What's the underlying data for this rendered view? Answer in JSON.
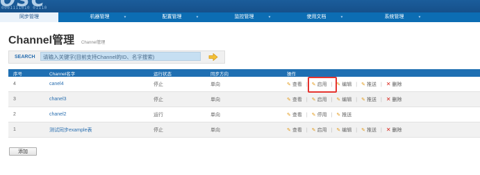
{
  "header": {
    "logo_text": "OSC",
    "logo_bits": "0001111010 01110"
  },
  "nav": {
    "items": [
      {
        "label": "同步管理",
        "active": true
      },
      {
        "label": "机器管理",
        "active": false
      },
      {
        "label": "配置管理",
        "active": false
      },
      {
        "label": "监控管理",
        "active": false
      },
      {
        "label": "使用文档",
        "active": false
      },
      {
        "label": "系统管理",
        "active": false
      }
    ],
    "arrow": "▼"
  },
  "page": {
    "title": "Channel管理",
    "subtitle": "Channel管理"
  },
  "search": {
    "label": "SEARCH",
    "placeholder": "请输入关键字(目前支持Channel的ID、名字搜索)"
  },
  "table": {
    "headers": [
      "序号",
      "Channel名字",
      "运行状态",
      "同步方向",
      "操作"
    ],
    "rows": [
      {
        "id": "4",
        "name": "canel4",
        "status": "停止",
        "running": false,
        "direction": "单向",
        "ops": [
          "查看",
          "启用",
          "编辑",
          "推送"
        ],
        "delete": "删除"
      },
      {
        "id": "3",
        "name": "chanel3",
        "status": "停止",
        "running": false,
        "direction": "单向",
        "ops": [
          "查看",
          "启用",
          "编辑",
          "推送"
        ],
        "delete": "删除"
      },
      {
        "id": "2",
        "name": "chanel2",
        "status": "运行",
        "running": true,
        "direction": "单向",
        "ops": [
          "查看",
          "停用",
          "推送"
        ],
        "delete": ""
      },
      {
        "id": "1",
        "name": "测试同步example表",
        "status": "停止",
        "running": false,
        "direction": "单向",
        "ops": [
          "查看",
          "启用",
          "编辑",
          "推送"
        ],
        "delete": "删除"
      }
    ]
  },
  "actions": {
    "add_label": "添加"
  },
  "colors": {
    "nav_bg": "#0c6db3",
    "header_bg": "#1f6fb2",
    "link": "#2a6fb0",
    "running": "#3a9a3a",
    "highlight": "#e5322d",
    "delete_icon": "#d9251c"
  }
}
